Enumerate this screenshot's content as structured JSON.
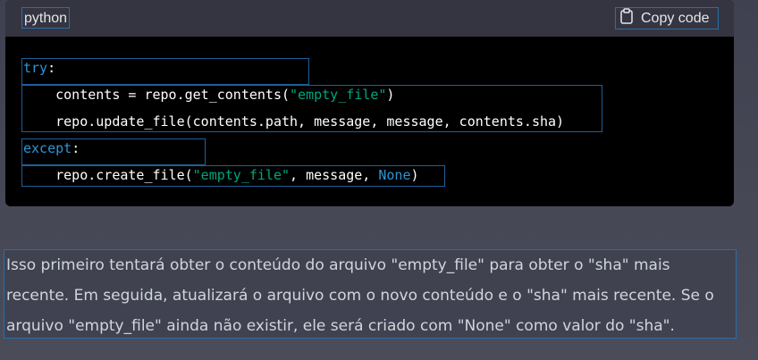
{
  "code_block": {
    "language": "python",
    "copy_label": "Copy code",
    "copy_icon": "clipboard-icon",
    "lines": [
      [
        {
          "text": "try",
          "cls": "kw"
        },
        {
          "text": ":",
          "cls": ""
        }
      ],
      [
        {
          "text": "    contents = repo.get_contents(",
          "cls": ""
        },
        {
          "text": "\"empty_file\"",
          "cls": "str"
        },
        {
          "text": ")",
          "cls": ""
        }
      ],
      [
        {
          "text": "    repo.update_file(contents.path, message, message, contents.sha)",
          "cls": ""
        }
      ],
      [
        {
          "text": "except",
          "cls": "kw"
        },
        {
          "text": ":",
          "cls": ""
        }
      ],
      [
        {
          "text": "    repo.create_file(",
          "cls": ""
        },
        {
          "text": "\"empty_file\"",
          "cls": "str"
        },
        {
          "text": ", message, ",
          "cls": ""
        },
        {
          "text": "None",
          "cls": "kw"
        },
        {
          "text": ")",
          "cls": ""
        }
      ]
    ]
  },
  "explanation": {
    "text": "Isso primeiro tentará obter o conteúdo do arquivo \"empty_file\" para obter o \"sha\" mais recente. Em seguida, atualizará o arquivo com o novo conteúdo e o \"sha\" mais recente. Se o arquivo \"empty_file\" ainda não existir, ele será criado com \"None\" como valor do \"sha\"."
  },
  "colors": {
    "keyword": "#2e95d3",
    "string": "#00a67d",
    "code_background": "#000000",
    "header_background": "#343541",
    "page_background": "#444654",
    "highlight_border": "#2b6da8"
  }
}
